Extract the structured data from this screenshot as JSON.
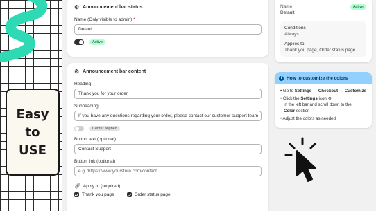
{
  "colors": {
    "teal": "#2fd9b3",
    "blue": "#5bc0f0",
    "active_badge_bg": "#b4fed2",
    "info_header_bg": "#91d0ff"
  },
  "promo": {
    "line1": "Easy",
    "line2": "to",
    "line3": "USE"
  },
  "status_card": {
    "title": "Announcement bar status",
    "icon": "gear-icon",
    "name_label": "Name (Only visible to admin)",
    "required_marker": "*",
    "name_value": "Default",
    "toggle_on": true,
    "badge": "Active"
  },
  "content_card": {
    "title": "Announcement bar content",
    "icon": "gear-icon",
    "heading_label": "Heading",
    "heading_value": "Thank you for your order",
    "subheading_label": "Subheading",
    "subheading_value": "If you have any questions regarding your order, please contact our customer support team",
    "center_toggle_on": false,
    "center_badge": "Center aligned",
    "button_text_label": "Button text (optional)",
    "button_text_value": "Contact Support",
    "button_link_label": "Button link (optional)",
    "button_link_placeholder": "e.g. 'https://www.yourstore.com/contact'",
    "apply_label": "Apply to (required)",
    "apply_icon": "link-icon",
    "checkbox_1": "Thank you page",
    "checkbox_2": "Order status page"
  },
  "summary_card": {
    "name_label": "Name",
    "name_value": "Default",
    "badge": "Active",
    "conditions_label": "Conditions",
    "conditions_value": "Always",
    "applies_label": "Applies to",
    "applies_value": "Thank you page, Order status page"
  },
  "info_card": {
    "title": "How to customize the colors",
    "icon": "info-icon",
    "step1_pre": "Go to",
    "step1_settings": "Settings",
    "step1_checkout": "Checkout",
    "step1_customize": "Customize",
    "arrow": "→",
    "step2_pre": "Click the",
    "step2_settings": "Settings",
    "step2_mid": "icon",
    "step2_icon": "gear-icon",
    "step2_line2": "in the left bar and scroll down to the",
    "step2_color": "Color",
    "step2_end": "section",
    "step3": "Adjust the colors as needed"
  }
}
